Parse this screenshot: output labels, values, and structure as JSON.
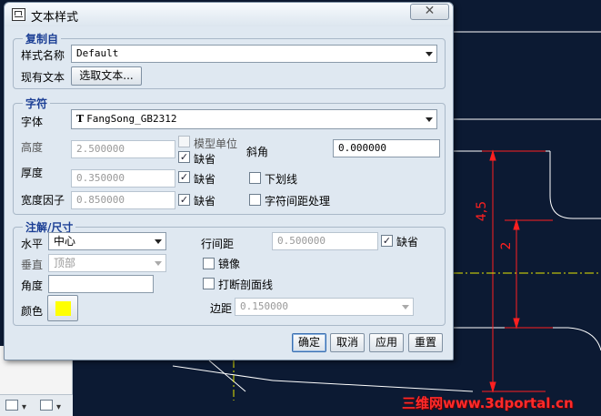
{
  "dialog": {
    "title": "文本样式",
    "close_label": "✕",
    "copy_from": {
      "legend": "复制自",
      "style_name_label": "样式名称",
      "style_name_value": "Default",
      "existing_text_label": "现有文本",
      "select_text_button": "选取文本..."
    },
    "character": {
      "legend": "字符",
      "font_label": "字体",
      "font_icon": "truetype-icon",
      "font_value": "FangSong_GB2312",
      "height_label": "高度",
      "height_value": "2.500000",
      "model_units_label": "模型单位",
      "height_default_label": "缺省",
      "thickness_label": "厚度",
      "thickness_value": "0.350000",
      "thickness_default_label": "缺省",
      "width_factor_label": "宽度因子",
      "width_factor_value": "0.850000",
      "width_factor_default_label": "缺省",
      "slant_label": "斜角",
      "slant_value": "0.000000",
      "underline_label": "下划线",
      "kerning_label": "字符间距处理"
    },
    "note": {
      "legend": "注解/尺寸",
      "horizontal_label": "水平",
      "horizontal_value": "中心",
      "vertical_label": "垂直",
      "vertical_value": "顶部",
      "angle_label": "角度",
      "angle_value": "",
      "color_label": "颜色",
      "color_value": "#ffff00",
      "line_spacing_label": "行间距",
      "line_spacing_value": "0.500000",
      "line_spacing_default_label": "缺省",
      "mirror_label": "镜像",
      "break_hatch_label": "打断剖面线",
      "margin_label": "边距",
      "margin_value": "0.150000"
    },
    "buttons": {
      "ok": "确定",
      "cancel": "取消",
      "apply": "应用",
      "reset": "重置"
    },
    "checked_mark": "✓"
  },
  "drawing": {
    "dim_large": "4,5",
    "dim_small": "2",
    "watermark": "三维网www.3dportal.cn",
    "line_color": "#ffffff",
    "dim_color": "#ff2020",
    "centerline_color": "#e6e600"
  }
}
